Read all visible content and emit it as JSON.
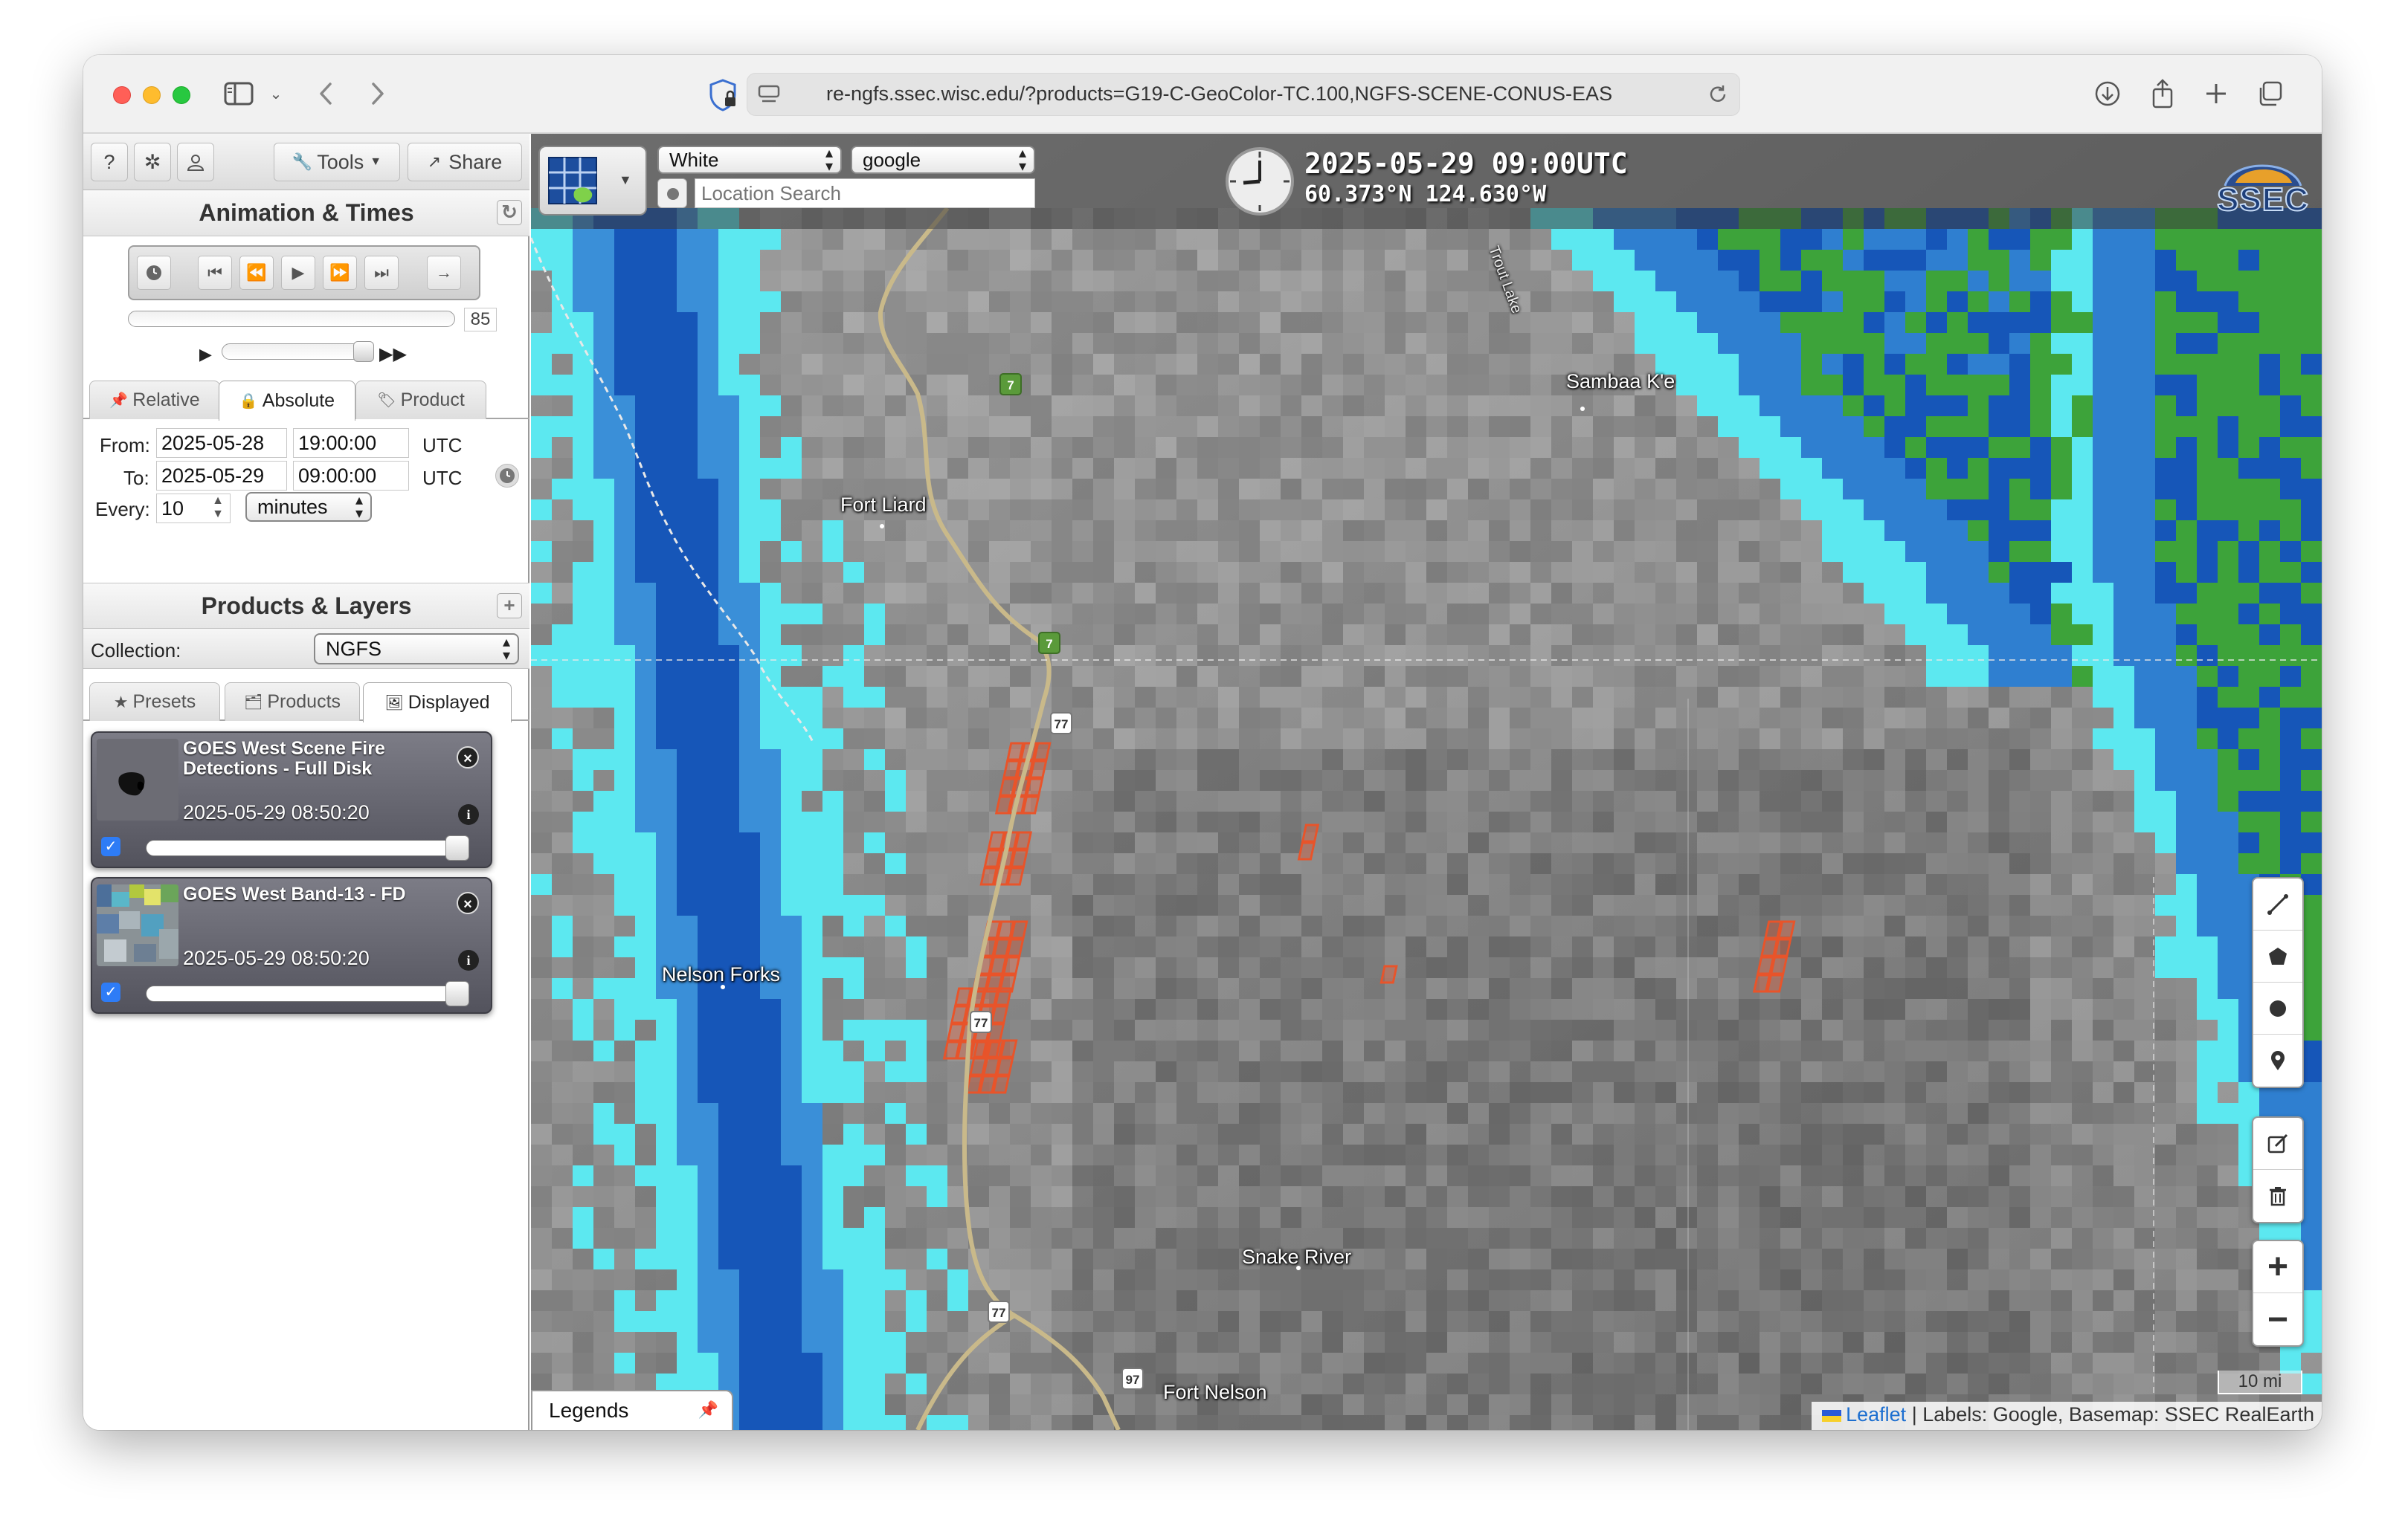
{
  "browser": {
    "url": "re-ngfs.ssec.wisc.edu/?products=G19-C-GeoColor-TC.100,NGFS-SCENE-CONUS-EAS"
  },
  "toolbar": {
    "help_label": "?",
    "tools_label": "Tools",
    "share_label": "Share"
  },
  "animation": {
    "title": "Animation & Times",
    "speed_value": "85"
  },
  "time_tabs": {
    "relative": "Relative",
    "absolute": "Absolute",
    "product": "Product"
  },
  "times": {
    "from_label": "From:",
    "from_date": "2025-05-28",
    "from_time": "19:00:00",
    "from_tz": "UTC",
    "to_label": "To:",
    "to_date": "2025-05-29",
    "to_time": "09:00:00",
    "to_tz": "UTC",
    "every_label": "Every:",
    "every_value": "10",
    "every_unit": "minutes"
  },
  "products": {
    "title": "Products & Layers",
    "collection_label": "Collection:",
    "collection_value": "NGFS",
    "tabs": {
      "presets": "Presets",
      "products": "Products",
      "displayed": "Displayed"
    }
  },
  "layers": [
    {
      "title": "GOES West Scene Fire Detections - Full Disk",
      "time": "2025-05-29 08:50:20",
      "opacity": 1.0
    },
    {
      "title": "GOES West Band-13 - FD",
      "time": "2025-05-29 08:50:20",
      "opacity": 1.0
    }
  ],
  "map": {
    "theme_select": "White",
    "labels_select": "google",
    "search_placeholder": "Location Search",
    "time_display": "2025-05-29 09:00UTC",
    "coords_display": "60.373°N 124.630°W",
    "logo_text": "SSEC",
    "places": {
      "sambaa_ke": "Sambaa K'e",
      "fort_liard": "Fort Liard",
      "nelson_forks": "Nelson Forks",
      "snake_river": "Snake River",
      "fort_nelson": "Fort Nelson",
      "trout_lake": "Trout Lake"
    },
    "routes": {
      "r7a": "7",
      "r7b": "7",
      "r77a": "77",
      "r77b": "77",
      "r77c": "77",
      "r97": "97"
    },
    "legends_label": "Legends",
    "attribution_link": "Leaflet",
    "attribution_text": " | Labels: Google, Basemap: SSEC RealEarth",
    "scale_label": "10 mi",
    "zoom_in": "+",
    "zoom_out": "−"
  },
  "colors": {
    "fire": "#e8542a",
    "cloud_cyan": "#5ce8f0",
    "cloud_blue": "#1656b8",
    "cloud_green": "#3da33a"
  }
}
